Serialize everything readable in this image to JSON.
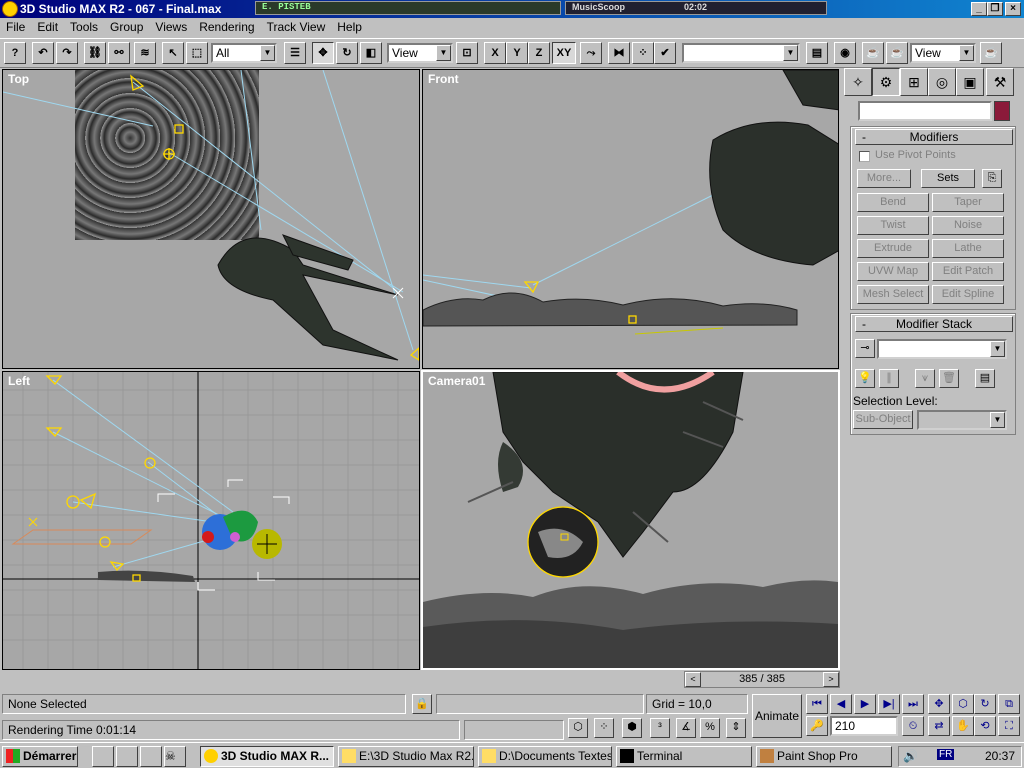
{
  "window": {
    "title": "3D Studio MAX R2 - 067 - Final.max",
    "player_text": "E. PISTEB",
    "musicscoop_label": "MusicScoop",
    "musicscoop_time": "02:02"
  },
  "menu": [
    "File",
    "Edit",
    "Tools",
    "Group",
    "Views",
    "Rendering",
    "Track View",
    "Help"
  ],
  "toolbar": {
    "selection_filter": "All",
    "ref_coord": "View",
    "axis_x": "X",
    "axis_y": "Y",
    "axis_z": "Z",
    "axis_xy": "XY",
    "named_selection": "",
    "render_type": "View"
  },
  "viewports": {
    "top": "Top",
    "front": "Front",
    "left": "Left",
    "camera": "Camera01"
  },
  "command_panel": {
    "name_field": "",
    "modifiers_title": "Modifiers",
    "use_pivot_points": "Use Pivot Points",
    "more": "More...",
    "sets": "Sets",
    "buttons": [
      [
        "Bend",
        "Taper"
      ],
      [
        "Twist",
        "Noise"
      ],
      [
        "Extrude",
        "Lathe"
      ],
      [
        "UVW Map",
        "Edit Patch"
      ],
      [
        "Mesh Select",
        "Edit Spline"
      ]
    ],
    "stack_title": "Modifier Stack",
    "selection_level": "Selection Level:",
    "sub_object": "Sub-Object",
    "accent_color": "#8b1a3a"
  },
  "timeslider": {
    "frame": "385 / 385"
  },
  "status": {
    "selection": "None Selected",
    "grid": "Grid = 10,0",
    "rendering_time": "Rendering Time  0:01:14",
    "animate": "Animate",
    "current_frame": "210"
  },
  "taskbar": {
    "start": "Démarrer",
    "tasks": [
      {
        "label": "3D Studio MAX R...",
        "active": true
      },
      {
        "label": "E:\\3D Studio Max R2...",
        "active": false
      },
      {
        "label": "D:\\Documents Textes",
        "active": false
      },
      {
        "label": "Terminal",
        "active": false
      },
      {
        "label": "Paint Shop Pro",
        "active": false
      }
    ],
    "lang": "FR",
    "clock": "20:37"
  }
}
